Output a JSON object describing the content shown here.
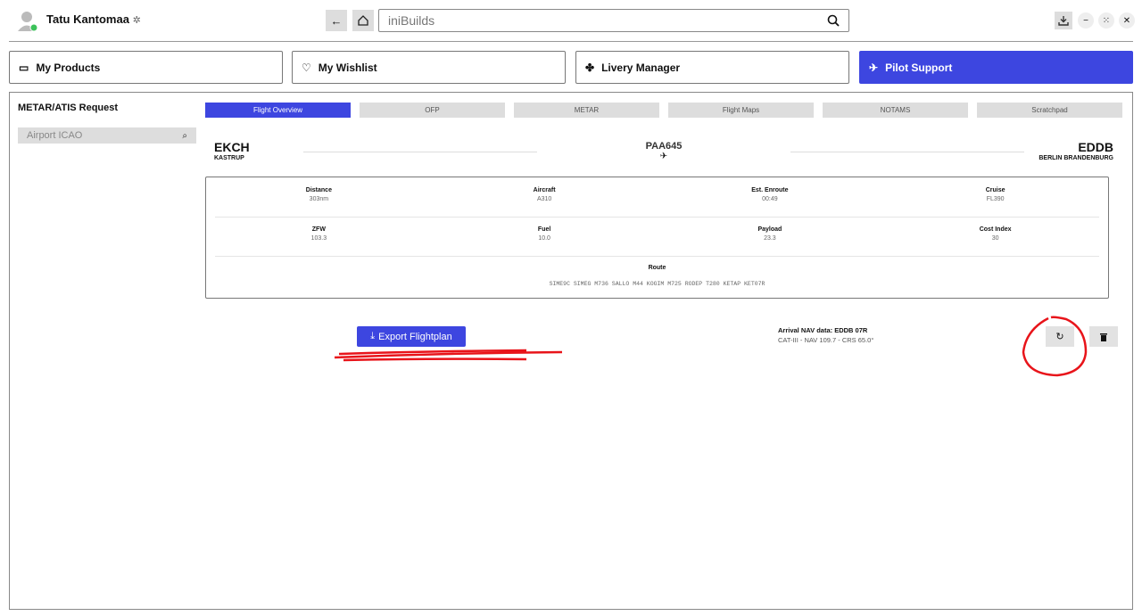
{
  "header": {
    "user_name": "Tatu Kantomaa",
    "search_value": "iniBuilds",
    "status_color": "#3cc25a"
  },
  "nav": [
    {
      "label": "My Products",
      "icon": "products-icon"
    },
    {
      "label": "My Wishlist",
      "icon": "heart-icon"
    },
    {
      "label": "Livery Manager",
      "icon": "puzzle-icon"
    },
    {
      "label": "Pilot Support",
      "icon": "plane-landing-icon",
      "active": true
    }
  ],
  "accent": "#3d46e0",
  "sidebar": {
    "title": "METAR/ATIS Request",
    "placeholder": "Airport ICAO"
  },
  "tabs": [
    "Flight Overview",
    "OFP",
    "METAR",
    "Flight Maps",
    "NOTAMS",
    "Scratchpad"
  ],
  "flight": {
    "origin": "EKCH",
    "origin_name": "KASTRUP",
    "callsign": "PAA645",
    "dest": "EDDB",
    "dest_name": "BERLIN BRANDENBURG"
  },
  "info": [
    {
      "label": "Distance",
      "value": "303nm"
    },
    {
      "label": "Aircraft",
      "value": "A310"
    },
    {
      "label": "Est. Enroute",
      "value": "00:49"
    },
    {
      "label": "Cruise",
      "value": "FL390"
    },
    {
      "label": "ZFW",
      "value": "103.3"
    },
    {
      "label": "Fuel",
      "value": "10.0"
    },
    {
      "label": "Payload",
      "value": "23.3"
    },
    {
      "label": "Cost Index",
      "value": "30"
    }
  ],
  "route": {
    "label": "Route",
    "value": "SIME9C SIMEG M736 SALLO M44 KOGIM M725 RODEP T280 KETAP KET07R"
  },
  "export_label": "Export Flightplan",
  "arrival": {
    "title": "Arrival NAV data: EDDB 07R",
    "detail": "CAT-III - NAV 109.7 - CRS 65.0°"
  }
}
